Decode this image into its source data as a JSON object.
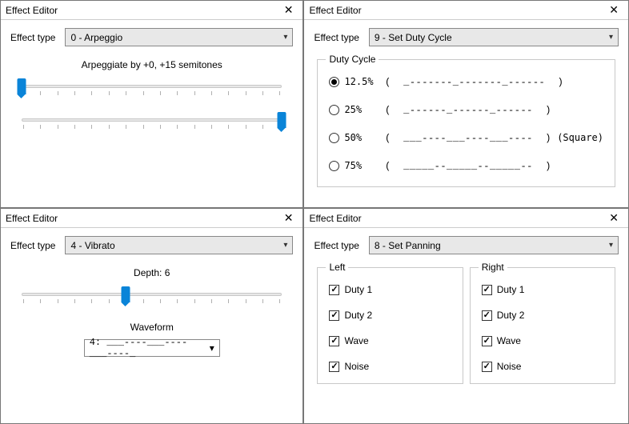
{
  "panels": {
    "tl": {
      "title": "Effect Editor",
      "effect_type_label": "Effect type",
      "effect_type_value": "0 - Arpeggio",
      "arpeggio_text": "Arpeggiate by +0, +15 semitones",
      "slider1_value": 0,
      "slider1_min": 0,
      "slider1_max": 15,
      "slider2_value": 15,
      "slider2_min": 0,
      "slider2_max": 15
    },
    "tr": {
      "title": "Effect Editor",
      "effect_type_label": "Effect type",
      "effect_type_value": "9 - Set Duty Cycle",
      "group_label": "Duty Cycle",
      "options": [
        {
          "percent": "12.5%",
          "pattern": "(  _-------_-------_------  )",
          "checked": true,
          "suffix": ""
        },
        {
          "percent": "25%",
          "pattern": "(  _------_------_------  )",
          "checked": false,
          "suffix": ""
        },
        {
          "percent": "50%",
          "pattern": "(  ___----___----___----  )",
          "checked": false,
          "suffix": "(Square)"
        },
        {
          "percent": "75%",
          "pattern": "(  _____--_____--_____--  )",
          "checked": false,
          "suffix": ""
        }
      ]
    },
    "bl": {
      "title": "Effect Editor",
      "effect_type_label": "Effect type",
      "effect_type_value": "4 - Vibrato",
      "depth_label": "Depth: 6",
      "depth_value": 6,
      "depth_min": 0,
      "depth_max": 15,
      "waveform_label": "Waveform",
      "waveform_value": "4: ___----___----___----_"
    },
    "br": {
      "title": "Effect Editor",
      "effect_type_label": "Effect type",
      "effect_type_value": "8 - Set Panning",
      "left_label": "Left",
      "right_label": "Right",
      "channels": [
        "Duty 1",
        "Duty 2",
        "Wave",
        "Noise"
      ],
      "left_checked": [
        true,
        true,
        true,
        true
      ],
      "right_checked": [
        true,
        true,
        true,
        true
      ]
    }
  }
}
